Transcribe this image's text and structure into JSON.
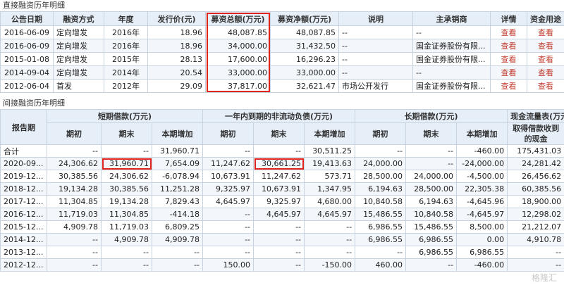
{
  "section1_title": "直接融资历年明细",
  "table1": {
    "headers": [
      "公告日期",
      "融资方式",
      "年度",
      "发行价(元)",
      "募资总额(万元)",
      "募资净额(万元)",
      "说明",
      "主承销商",
      "详情",
      "资金用途"
    ],
    "rows": [
      [
        "2016-06-09",
        "定向增发",
        "2016年",
        "18.96",
        "48,087.85",
        "48,087.85",
        "--",
        "--",
        "查看",
        "查看"
      ],
      [
        "2016-06-09",
        "定向增发",
        "2016年",
        "18.96",
        "34,000.00",
        "31,432.50",
        "--",
        "国金证券股份有限...",
        "查看",
        "查看"
      ],
      [
        "2015-01-08",
        "定向增发",
        "2015年",
        "28.13",
        "17,600.00",
        "16,296.23",
        "--",
        "国金证券股份有限...",
        "查看",
        "查看"
      ],
      [
        "2014-09-04",
        "定向增发",
        "2014年",
        "20.54",
        "33,000.00",
        "33,000.00",
        "--",
        "--",
        "查看",
        "查看"
      ],
      [
        "2012-06-04",
        "首发",
        "2012年",
        "29.09",
        "37,817.00",
        "32,621.47",
        "市场公开发行",
        "国金证券股份有限...",
        "查看",
        "查看"
      ]
    ]
  },
  "section2_title": "间接融资历年明细",
  "table2": {
    "report_label": "报告期",
    "groups": [
      "短期借款(万元)",
      "一年内到期的非流动负债(万元)",
      "长期借款(万元)",
      "现金流量表(万元)"
    ],
    "sub_headers": [
      "期初",
      "期末",
      "本期增加",
      "期初",
      "期末",
      "本期增加",
      "期初",
      "期末",
      "本期增加",
      "取得借款收到的现金"
    ],
    "rows": [
      [
        "合计",
        "--",
        "--",
        "31,960.71",
        "--",
        "--",
        "30,511.25",
        "--",
        "--",
        "-460.00",
        "175,431.03"
      ],
      [
        "2020-09...",
        "24,306.62",
        "31,960.71",
        "7,654.09",
        "11,247.62",
        "30,661.25",
        "19,413.63",
        "24,000.00",
        "--",
        "-24,000.00",
        "24,281.42"
      ],
      [
        "2019-12...",
        "30,385.56",
        "24,306.62",
        "-6,078.94",
        "10,673.91",
        "11,247.62",
        "573.71",
        "28,500.00",
        "24,000.00",
        "-4,500.00",
        "26,456.62"
      ],
      [
        "2018-12...",
        "19,134.28",
        "30,385.56",
        "11,251.28",
        "9,325.97",
        "10,673.91",
        "1,347.95",
        "6,194.63",
        "28,500.00",
        "22,305.38",
        "60,385.56"
      ],
      [
        "2017-12...",
        "11,304.85",
        "19,134.28",
        "7,829.43",
        "4,645.97",
        "9,325.97",
        "4,680.00",
        "10,840.58",
        "6,194.63",
        "-4,645.96",
        "18,900.00"
      ],
      [
        "2016-12...",
        "11,719.03",
        "11,304.85",
        "-414.18",
        "--",
        "4,645.97",
        "4,645.97",
        "15,486.55",
        "10,840.58",
        "-4,645.97",
        "12,298.02"
      ],
      [
        "2015-12...",
        "4,909.78",
        "11,719.03",
        "6,809.25",
        "--",
        "--",
        "--",
        "6,986.55",
        "15,486.55",
        "8,500.00",
        "21,212.07"
      ],
      [
        "2014-12...",
        "--",
        "4,909.78",
        "4,909.78",
        "--",
        "--",
        "--",
        "6,986.55",
        "6,986.55",
        "0.00",
        "4,910.78"
      ],
      [
        "2013-12...",
        "--",
        "--",
        "--",
        "--",
        "--",
        "--",
        "--",
        "6,986.55",
        "6,986.55",
        "--"
      ],
      [
        "2012-12...",
        "--",
        "--",
        "--",
        "150.00",
        "--",
        "-150.00",
        "460.00",
        "--",
        "-460.00",
        "--"
      ]
    ]
  },
  "watermark": "格隆汇"
}
